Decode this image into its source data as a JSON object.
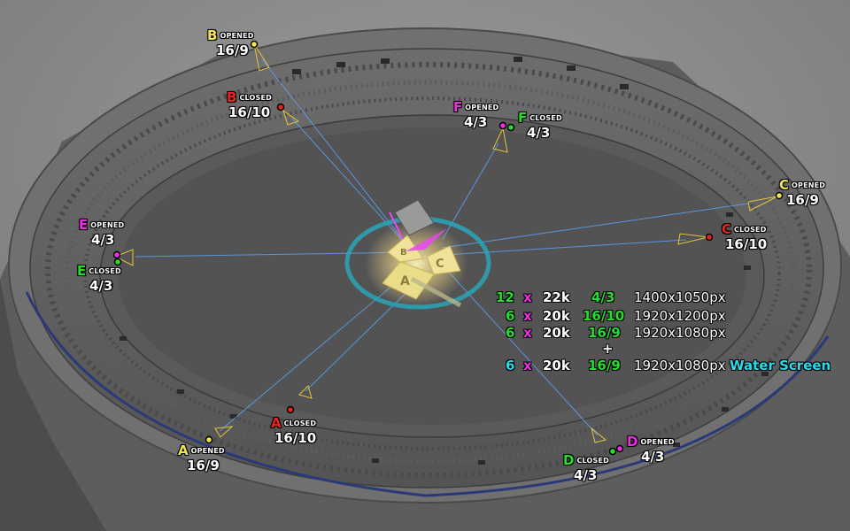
{
  "colors": {
    "yellow": "#f2e64a",
    "red": "#e8241c",
    "magenta": "#ee2ce0",
    "green": "#24dd2c",
    "cyan": "#2bdbe8",
    "projection_line": "#5aa8ff",
    "stage_ring": "#2aa6b8"
  },
  "projectors": {
    "b_opened": {
      "letter": "B",
      "status": "OPENED",
      "ratio": "16/9"
    },
    "b_closed": {
      "letter": "B",
      "status": "CLOSED",
      "ratio": "16/10"
    },
    "f_opened": {
      "letter": "F",
      "status": "OPENED",
      "ratio": "4/3"
    },
    "f_closed": {
      "letter": "F",
      "status": "CLOSED",
      "ratio": "4/3"
    },
    "c_opened": {
      "letter": "C",
      "status": "OPENED",
      "ratio": "16/9"
    },
    "c_closed": {
      "letter": "C",
      "status": "CLOSED",
      "ratio": "16/10"
    },
    "e_opened": {
      "letter": "E",
      "status": "OPENED",
      "ratio": "4/3"
    },
    "e_closed": {
      "letter": "E",
      "status": "CLOSED",
      "ratio": "4/3"
    },
    "a_opened": {
      "letter": "A",
      "status": "OPENED",
      "ratio": "16/9"
    },
    "a_closed": {
      "letter": "A",
      "status": "CLOSED",
      "ratio": "16/10"
    },
    "d_opened": {
      "letter": "D",
      "status": "OPENED",
      "ratio": "4/3"
    },
    "d_closed": {
      "letter": "D",
      "status": "CLOSED",
      "ratio": "4/3"
    }
  },
  "stage_letters": [
    "A",
    "B",
    "C"
  ],
  "spec_table": {
    "rows": [
      {
        "count": "12",
        "x": "x",
        "power": "22k",
        "ratio": "4/3",
        "res": "1400x1050px",
        "extra": ""
      },
      {
        "count": "6",
        "x": "x",
        "power": "20k",
        "ratio": "16/10",
        "res": "1920x1200px",
        "extra": ""
      },
      {
        "count": "6",
        "x": "x",
        "power": "20k",
        "ratio": "16/9",
        "res": "1920x1080px",
        "extra": ""
      },
      {
        "count": "6",
        "x": "x",
        "power": "20k",
        "ratio": "16/9",
        "res": "1920x1080px",
        "extra": "Water Screen"
      }
    ],
    "plus": "+"
  }
}
